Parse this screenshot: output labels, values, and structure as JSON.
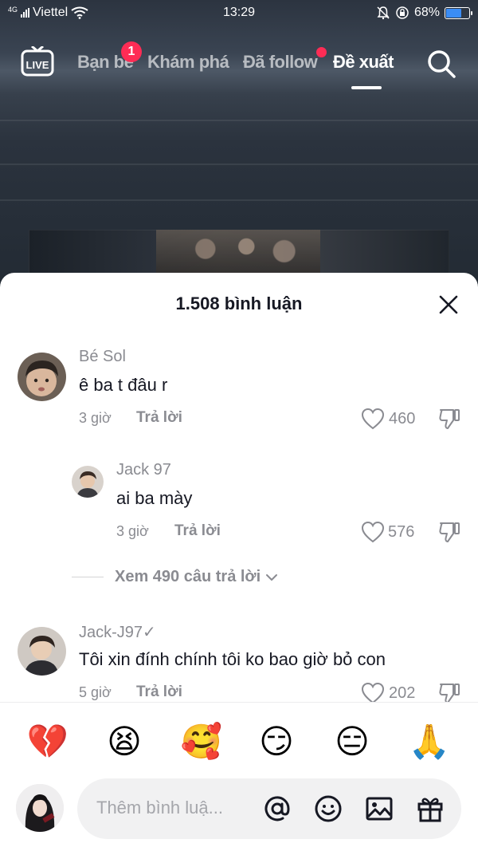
{
  "status_bar": {
    "network_type": "4G",
    "carrier": "Viettel",
    "time": "13:29",
    "battery_percent": "68%",
    "battery_level": 0.68,
    "icons": [
      "signal-icon",
      "wifi-icon",
      "mute-icon",
      "rotation-lock-icon",
      "battery-icon"
    ]
  },
  "top_nav": {
    "live_label": "LIVE",
    "tabs": [
      {
        "label": "Bạn bè",
        "badge": "1"
      },
      {
        "label": "Khám phá"
      },
      {
        "label": "Đã follow",
        "dot": true
      },
      {
        "label": "Đề xuất",
        "active": true
      }
    ]
  },
  "sheet": {
    "title": "1.508 bình luận",
    "comments": [
      {
        "username": "Bé Sol",
        "text": "ê ba t đâu r",
        "time": "3 giờ",
        "reply_label": "Trả lời",
        "likes": "460"
      },
      {
        "username": "Jack 97",
        "text": "ai ba mày",
        "time": "3 giờ",
        "reply_label": "Trả lời",
        "likes": "576"
      },
      {
        "username": "Jack-J97✓",
        "text": "Tôi xin đính chính tôi ko bao giờ bỏ con",
        "time": "5 giờ",
        "reply_label": "Trả lời",
        "likes": "202"
      }
    ],
    "view_replies": "Xem 490 câu trả lời"
  },
  "bottom_bar": {
    "emojis": [
      "💔",
      "😫",
      "🥰",
      "😏",
      "😑",
      "🙏"
    ],
    "input_placeholder": "Thêm bình luậ...",
    "icons": [
      "mention-icon",
      "emoji-icon",
      "image-icon",
      "gift-icon"
    ]
  },
  "colors": {
    "accent": "#fe2c55",
    "battery": "#3b8df5",
    "text_primary": "#161823",
    "text_secondary": "#8a8b91"
  }
}
